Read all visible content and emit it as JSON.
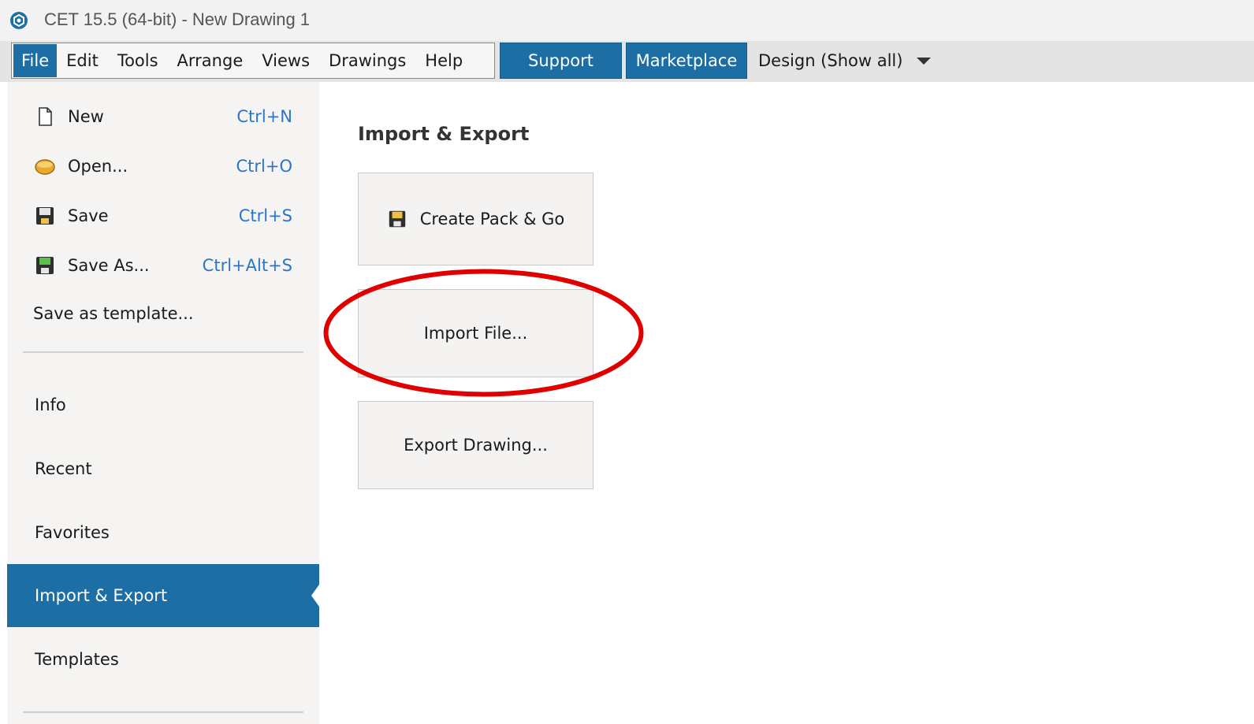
{
  "window": {
    "title": "CET 15.5 (64-bit) - New Drawing 1",
    "logo_icon": "cet-logo-icon"
  },
  "menubar": {
    "items": [
      "File",
      "Edit",
      "Tools",
      "Arrange",
      "Views",
      "Drawings",
      "Help"
    ],
    "active": "File",
    "support_label": "Support",
    "marketplace_label": "Marketplace",
    "design_dropdown": "Design (Show all)"
  },
  "file_commands": [
    {
      "label": "New",
      "shortcut": "Ctrl+N",
      "icon": "new-document-icon"
    },
    {
      "label": "Open...",
      "shortcut": "Ctrl+O",
      "icon": "open-folder-icon"
    },
    {
      "label": "Save",
      "shortcut": "Ctrl+S",
      "icon": "save-disk-icon"
    },
    {
      "label": "Save As...",
      "shortcut": "Ctrl+Alt+S",
      "icon": "save-as-disk-icon"
    },
    {
      "label": "Save as template..."
    }
  ],
  "nav": {
    "items": [
      "Info",
      "Recent",
      "Favorites",
      "Import & Export",
      "Templates"
    ],
    "selected": "Import & Export"
  },
  "main": {
    "title": "Import & Export",
    "tiles": {
      "pack_and_go": "Create Pack & Go",
      "import_file": "Import File...",
      "export_drawing": "Export Drawing..."
    }
  },
  "colors": {
    "accent": "#1c6ea4",
    "shortcut": "#2a76c6",
    "annotation": "#e00000"
  }
}
